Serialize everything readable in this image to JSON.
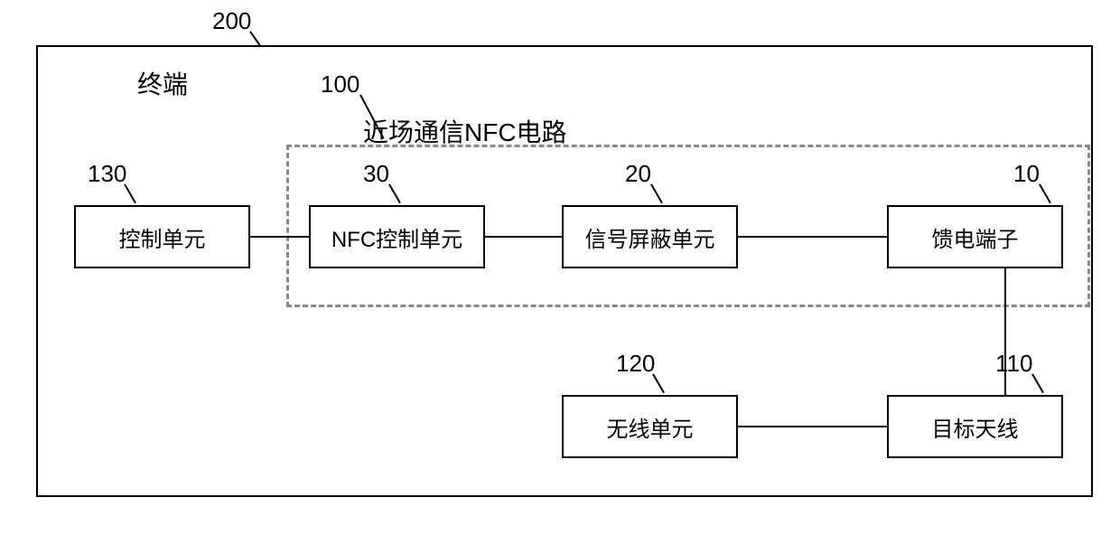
{
  "labels": {
    "terminal": "终端",
    "nfc_circuit_title": "近场通信NFC电路",
    "ref_200": "200",
    "ref_100": "100",
    "ref_130": "130",
    "ref_30": "30",
    "ref_20": "20",
    "ref_10": "10",
    "ref_120": "120",
    "ref_110": "110"
  },
  "blocks": {
    "control_unit": "控制单元",
    "nfc_control_unit": "NFC控制单元",
    "signal_shield_unit": "信号屏蔽单元",
    "feed_terminal": "馈电端子",
    "wireless_unit": "无线单元",
    "target_antenna": "目标天线"
  }
}
